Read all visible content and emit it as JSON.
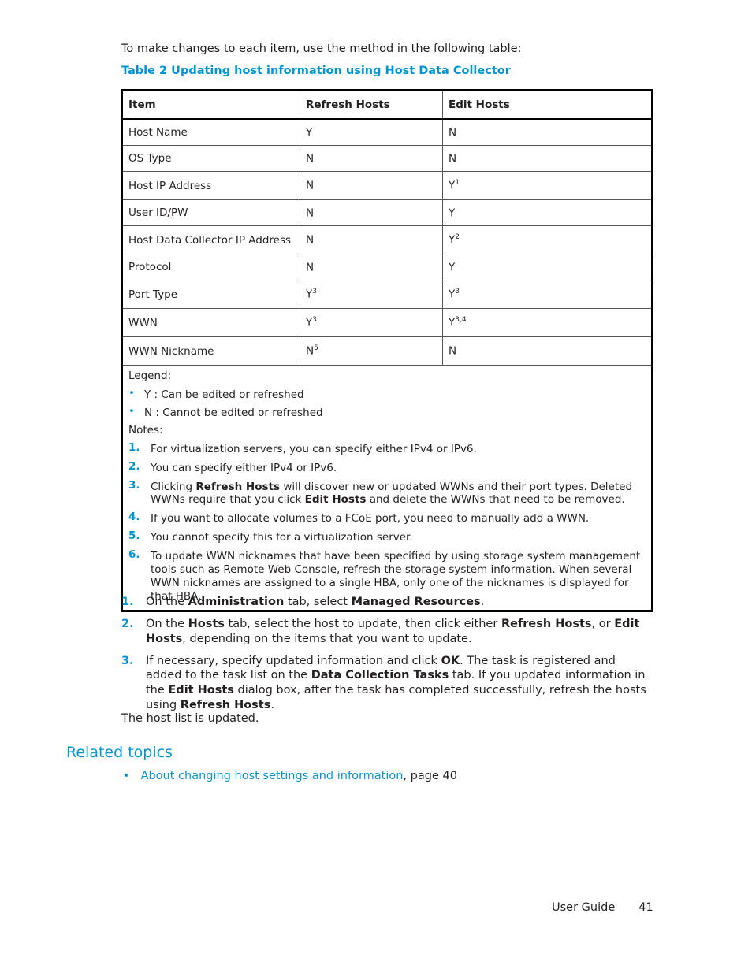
{
  "intro": "To make changes to each item, use the method in the following table:",
  "caption": "Table 2 Updating host information using Host Data Collector",
  "table": {
    "headers": [
      "Item",
      "Refresh Hosts",
      "Edit Hosts"
    ],
    "rows": [
      {
        "item": "Host Name",
        "refresh": "Y",
        "refresh_sup": "",
        "edit": "N",
        "edit_sup": ""
      },
      {
        "item": "OS Type",
        "refresh": "N",
        "refresh_sup": "",
        "edit": "N",
        "edit_sup": ""
      },
      {
        "item": "Host IP Address",
        "refresh": "N",
        "refresh_sup": "",
        "edit": "Y",
        "edit_sup": "1"
      },
      {
        "item": "User ID/PW",
        "refresh": "N",
        "refresh_sup": "",
        "edit": "Y",
        "edit_sup": ""
      },
      {
        "item": "Host Data Collector IP Address",
        "refresh": "N",
        "refresh_sup": "",
        "edit": "Y",
        "edit_sup": "2"
      },
      {
        "item": "Protocol",
        "refresh": "N",
        "refresh_sup": "",
        "edit": "Y",
        "edit_sup": ""
      },
      {
        "item": "Port Type",
        "refresh": "Y",
        "refresh_sup": "3",
        "edit": "Y",
        "edit_sup": "3"
      },
      {
        "item": "WWN",
        "refresh": "Y",
        "refresh_sup": "3",
        "edit": "Y",
        "edit_sup": "3,4"
      },
      {
        "item": "WWN Nickname",
        "refresh": "N",
        "refresh_sup": "5",
        "edit": "N",
        "edit_sup": ""
      }
    ],
    "legend_label": "Legend:",
    "legend": [
      "Y : Can be edited or refreshed",
      "N : Cannot be edited or refreshed"
    ],
    "notes_label": "Notes:",
    "notes": {
      "n1": "For virtualization servers, you can specify either IPv4 or IPv6.",
      "n2": "You can specify either IPv4 or IPv6.",
      "n3_a": "Clicking ",
      "n3_b": "Refresh Hosts",
      "n3_c": " will discover new or updated WWNs and their port types. Deleted WWNs require that you click ",
      "n3_d": "Edit Hosts",
      "n3_e": " and delete the WWNs that need to be removed.",
      "n4": "If you want to allocate volumes to a FCoE port, you need to manually add a WWN.",
      "n5": "You cannot specify this for a virtualization server.",
      "n6": "To update WWN nicknames that have been specified by using storage system management tools such as Remote Web Console, refresh the storage system information. When several WWN nicknames are assigned to a single HBA, only one of the nicknames is displayed for that HBA."
    }
  },
  "steps": {
    "s1": [
      "On the ",
      "Administration",
      " tab, select ",
      "Managed Resources",
      "."
    ],
    "s2": [
      "On the ",
      "Hosts",
      " tab, select the host to update, then click either ",
      "Refresh Hosts",
      ", or ",
      "Edit Hosts",
      ", depending on the items that you want to update."
    ],
    "s3": [
      "If necessary, specify updated information and click ",
      "OK",
      ". The task is registered and added to the task list on the ",
      "Data Collection Tasks",
      " tab. If you updated information in the ",
      "Edit Hosts",
      " dialog box, after the task has completed successfully, refresh the hosts using ",
      "Refresh Hosts",
      "."
    ]
  },
  "result": "The host list is updated.",
  "related": {
    "heading": "Related topics",
    "link": "About changing host settings and information",
    "suffix": ", page 40"
  },
  "footer": {
    "title": "User Guide",
    "page": "41"
  },
  "numbers": [
    "1.",
    "2.",
    "3.",
    "4.",
    "5.",
    "6."
  ],
  "bullet": "•"
}
